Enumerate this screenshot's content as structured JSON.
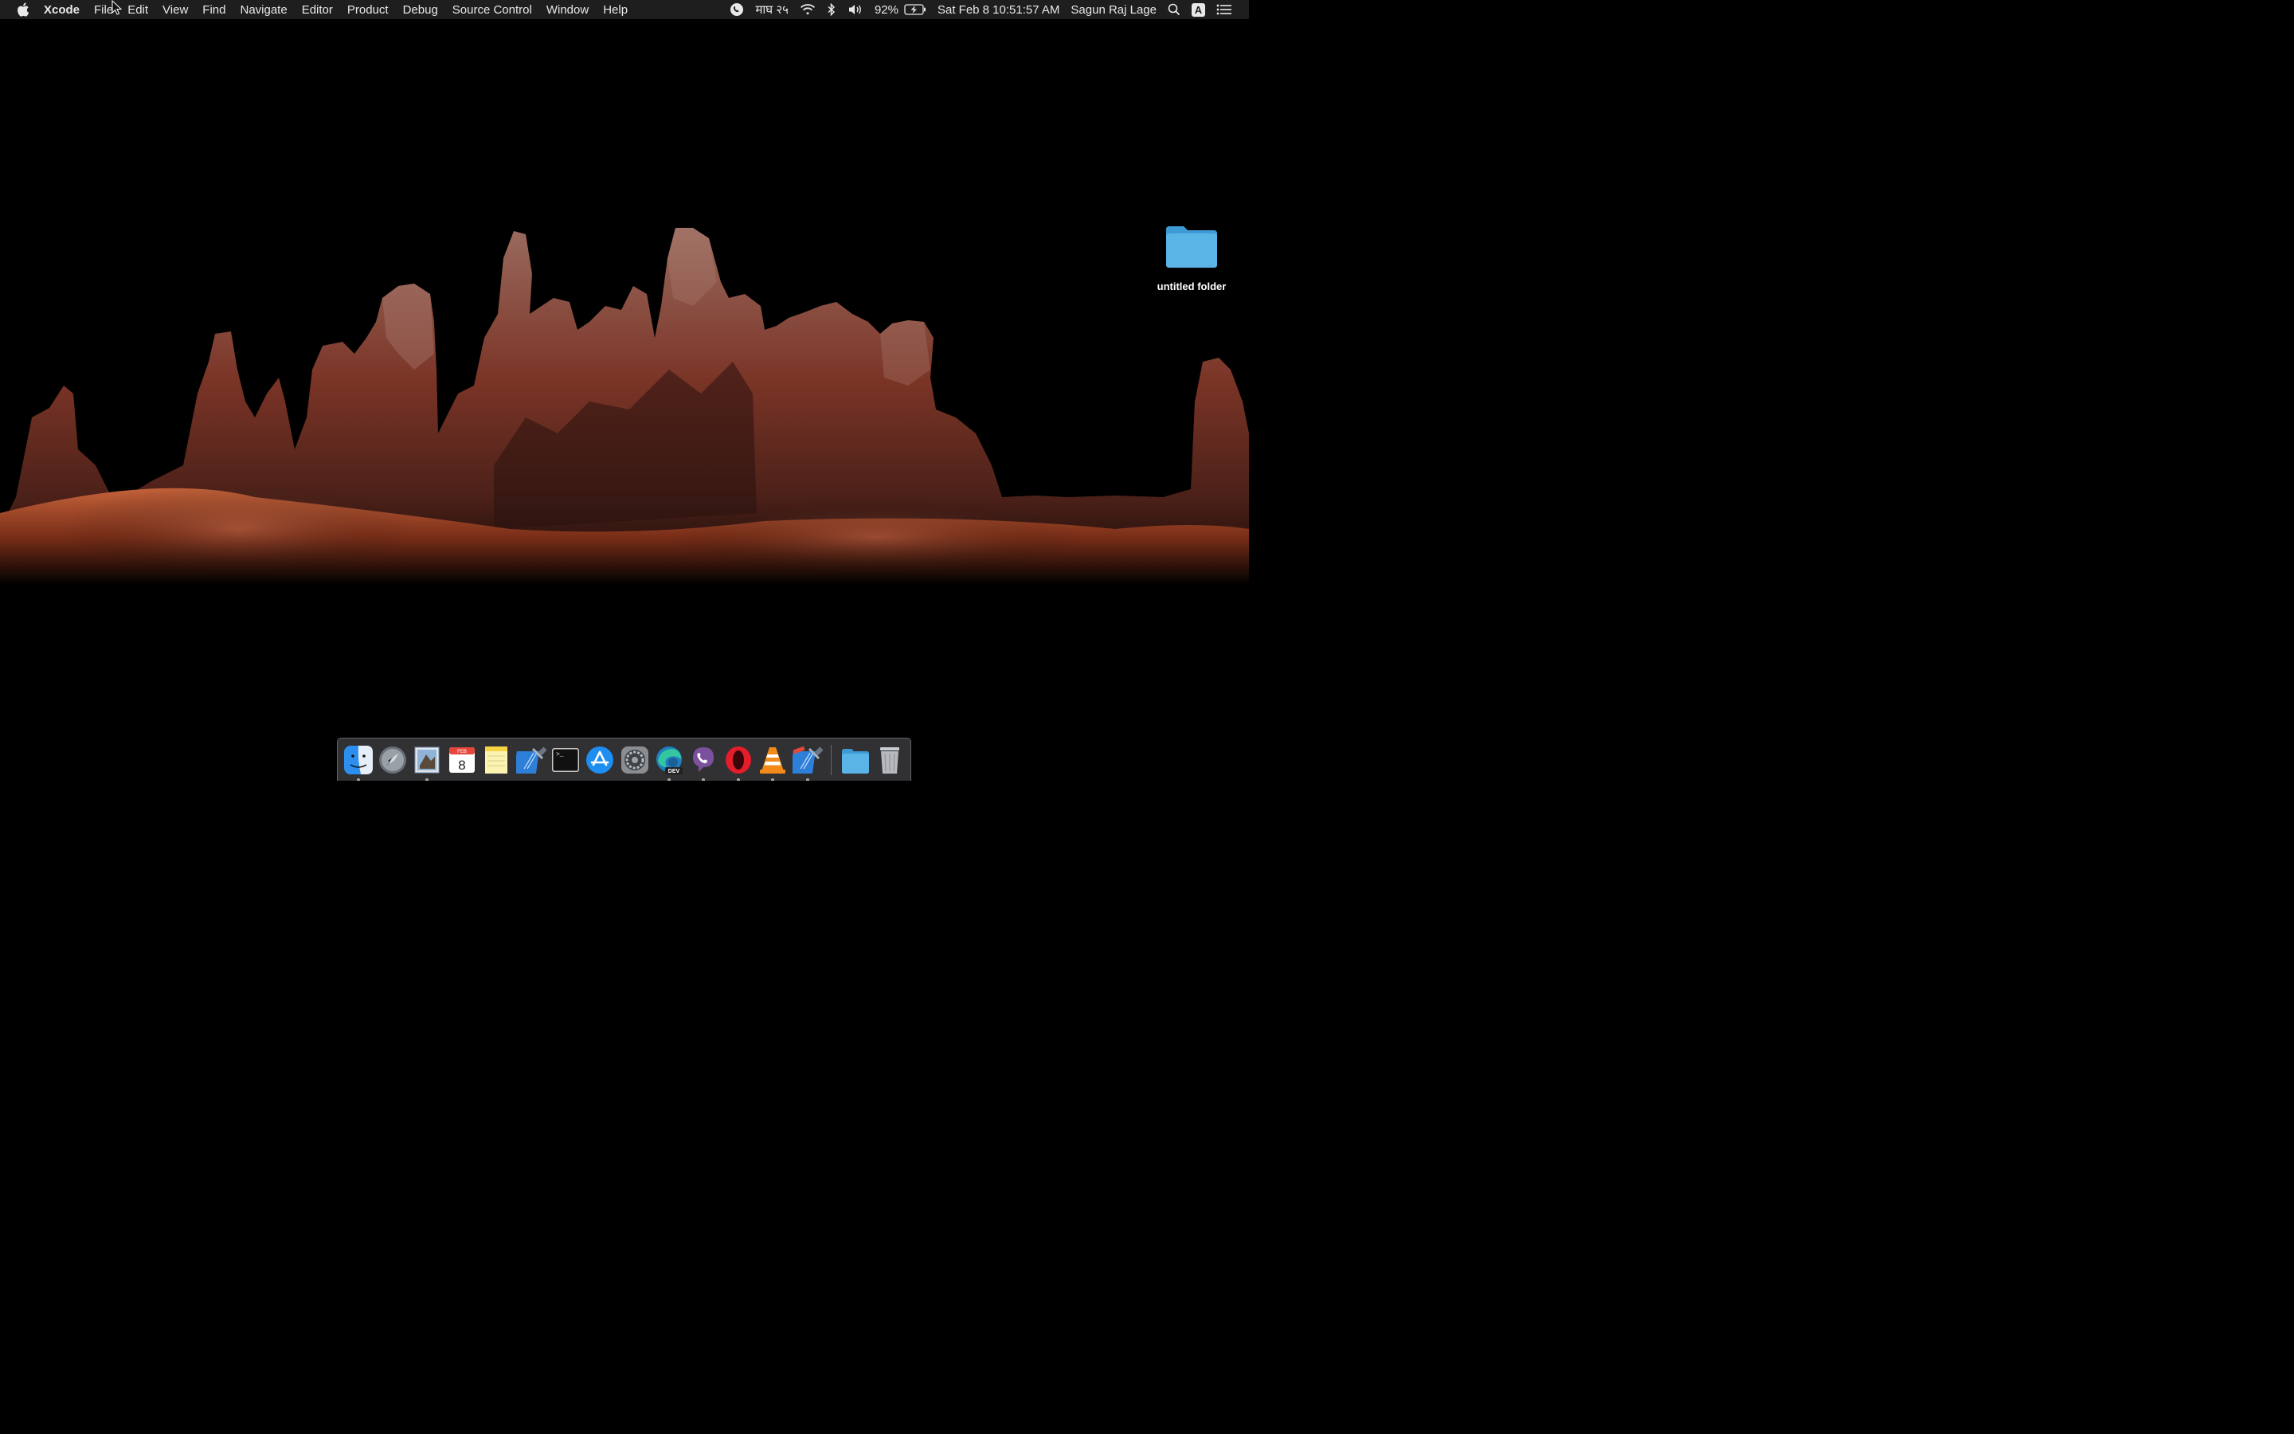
{
  "menubar": {
    "app_name": "Xcode",
    "menus": [
      "File",
      "Edit",
      "View",
      "Find",
      "Navigate",
      "Editor",
      "Product",
      "Debug",
      "Source Control",
      "Window",
      "Help"
    ],
    "nepali_date": "माघ २५",
    "battery_percent": "92%",
    "datetime": "Sat Feb 8  10:51:57 AM",
    "user_name": "Sagun Raj Lage",
    "input_source": "A"
  },
  "desktop": {
    "folder_label": "untitled folder"
  },
  "dock": {
    "calendar_month": "FEB",
    "calendar_day": "8",
    "edge_badge": "DEV",
    "apps": [
      {
        "icon": "finder-icon",
        "running": true
      },
      {
        "icon": "launchpad-icon",
        "running": false
      },
      {
        "icon": "mail-icon",
        "running": true
      },
      {
        "icon": "calendar-icon",
        "running": false
      },
      {
        "icon": "notes-icon",
        "running": false
      },
      {
        "icon": "xcode-icon",
        "running": false
      },
      {
        "icon": "terminal-icon",
        "running": false
      },
      {
        "icon": "app-store-icon",
        "running": false
      },
      {
        "icon": "system-preferences-icon",
        "running": false
      },
      {
        "icon": "edge-dev-icon",
        "running": true
      },
      {
        "icon": "viber-icon",
        "running": true
      },
      {
        "icon": "opera-icon",
        "running": true
      },
      {
        "icon": "vlc-icon",
        "running": true
      },
      {
        "icon": "xcode-beta-icon",
        "running": true
      },
      {
        "icon": "downloads-folder-icon",
        "running": false
      },
      {
        "icon": "trash-icon",
        "running": false
      }
    ]
  },
  "colors": {
    "menubar_bg": "#1e1e1e",
    "folder_blue": "#5ab4e6",
    "rock_red": "#8a3a2a"
  }
}
